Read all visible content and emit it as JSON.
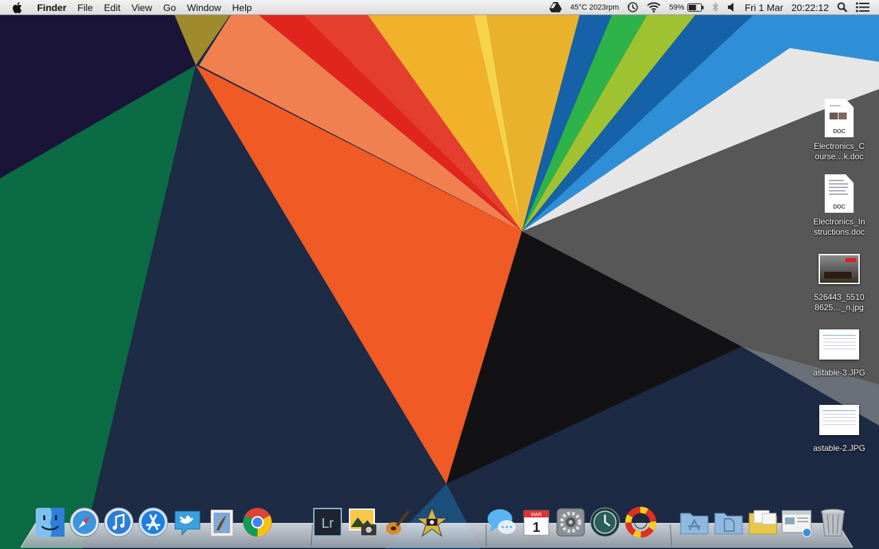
{
  "menubar": {
    "app_name": "Finder",
    "menus": [
      "File",
      "Edit",
      "View",
      "Go",
      "Window",
      "Help"
    ],
    "status": {
      "fan": "45°C 2023rpm",
      "battery": "59%",
      "date": "Fri 1 Mar",
      "time": "20:22:12"
    }
  },
  "desktop_icons": [
    {
      "line1": "Electronics_C",
      "line2": "ourse…k.doc",
      "kind": "doc",
      "tag": "DOC"
    },
    {
      "line1": "Electronics_In",
      "line2": "structions.doc",
      "kind": "doc",
      "tag": "DOC"
    },
    {
      "line1": "526443_5510",
      "line2": "8625…_n.jpg",
      "kind": "photo"
    },
    {
      "line1": "astable-3.JPG",
      "line2": "",
      "kind": "sheet"
    },
    {
      "line1": "astable-2.JPG",
      "line2": "",
      "kind": "sheet"
    }
  ],
  "dock": {
    "apps": [
      "finder-icon",
      "safari-icon",
      "itunes-icon",
      "app-store-icon",
      "twitter-icon",
      "mail-stamp-icon",
      "chrome-icon",
      "lightroom-icon",
      "iphoto-icon",
      "garageband-icon",
      "imovie-icon",
      "messages-icon",
      "calendar-icon",
      "system-preferences-icon",
      "time-machine-icon",
      "lifesaver-icon",
      "applications-folder-icon",
      "documents-folder-icon",
      "downloads-folder-icon",
      "finder-window-icon",
      "trash-icon"
    ],
    "lightroom_label": "Lr",
    "calendar_month": "MAR",
    "calendar_day": "1"
  },
  "colors": {
    "orange": "#f05a24",
    "navy": "#1c2a44",
    "green": "#0a6b44",
    "black": "#121214",
    "yellow": "#f1b12a",
    "red": "#e0251e",
    "gray": "#575757",
    "blue": "#2f8fd6"
  }
}
